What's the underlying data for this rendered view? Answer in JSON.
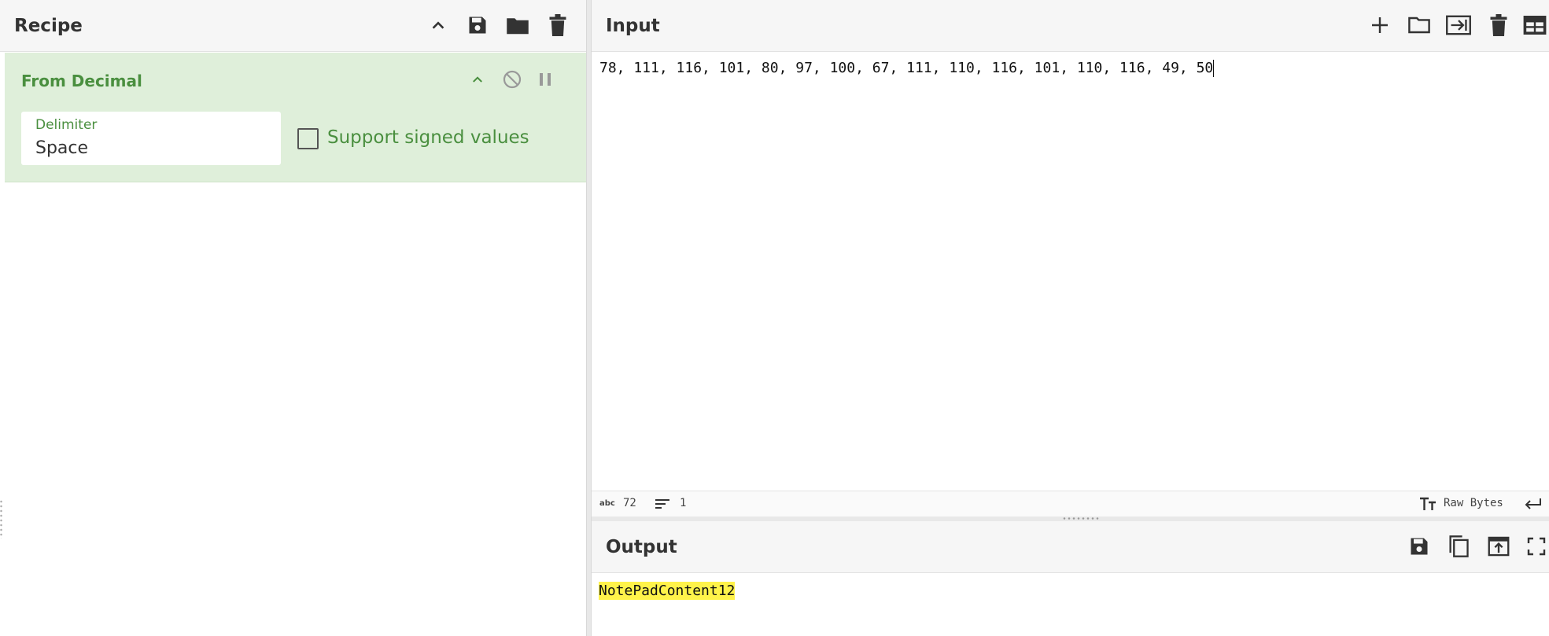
{
  "recipe": {
    "title": "Recipe",
    "icons": [
      "collapse-all-icon",
      "save-icon",
      "open-folder-icon",
      "trash-icon"
    ],
    "operation": {
      "name": "From Decimal",
      "delimiter_label": "Delimiter",
      "delimiter_value": "Space",
      "signed_label": "Support signed values",
      "signed_checked": false
    }
  },
  "input": {
    "title": "Input",
    "text": "78, 111, 116, 101, 80, 97, 100, 67, 111, 110, 116, 101, 110, 116, 49, 50",
    "status": {
      "length_label": "abc",
      "length": "72",
      "lines": "1",
      "encoding": "Raw Bytes"
    }
  },
  "output": {
    "title": "Output",
    "text": "NotePadContent12"
  },
  "colors": {
    "accent_green": "#4a8f3f",
    "card_bg": "#dfefda",
    "highlight": "#fff34a"
  }
}
